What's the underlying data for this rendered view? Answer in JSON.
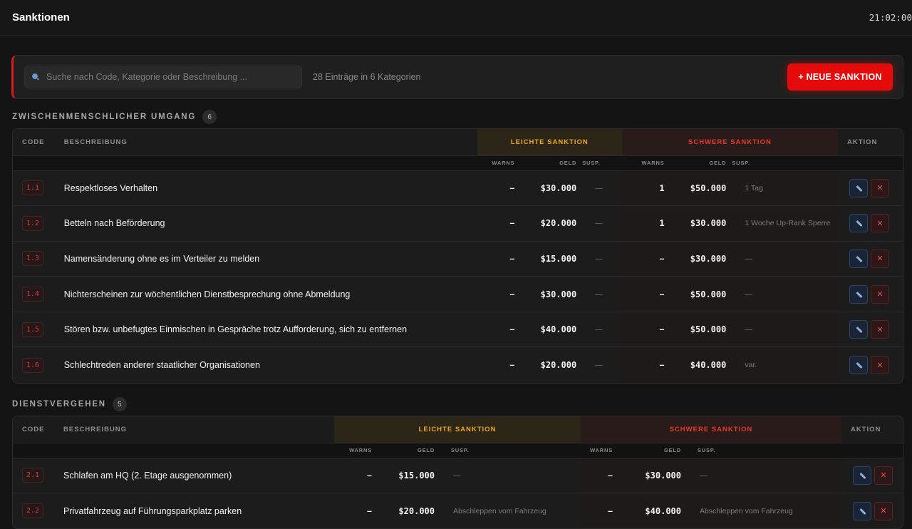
{
  "header": {
    "title": "Sanktionen",
    "clock": "21:02:00"
  },
  "toolbar": {
    "search_placeholder": "Suche nach Code, Kategorie oder Beschreibung ...",
    "entry_count": "28 Einträge in 6 Kategorien",
    "new_button": "+ NEUE SANKTION"
  },
  "columns": {
    "code": "CODE",
    "desc": "BESCHREIBUNG",
    "light": "LEICHTE SANKTION",
    "heavy": "SCHWERE SANKTION",
    "action": "AKTION",
    "warns": "WARNS",
    "geld": "GELD",
    "susp": "SUSP."
  },
  "sections": [
    {
      "title": "ZWISCHENMENSCHLICHER UMGANG",
      "count": "6",
      "rows": [
        {
          "code": "1.1",
          "desc": "Respektloses Verhalten",
          "l_warns": "–",
          "l_geld": "$30.000",
          "l_susp": "—",
          "h_warns": "1",
          "h_geld": "$50.000",
          "h_susp": "1 Tag"
        },
        {
          "code": "1.2",
          "desc": "Betteln nach Beförderung",
          "l_warns": "–",
          "l_geld": "$20.000",
          "l_susp": "—",
          "h_warns": "1",
          "h_geld": "$30.000",
          "h_susp": "1 Woche Up-Rank Sperre"
        },
        {
          "code": "1.3",
          "desc": "Namensänderung ohne es im Verteiler zu melden",
          "l_warns": "–",
          "l_geld": "$15.000",
          "l_susp": "—",
          "h_warns": "–",
          "h_geld": "$30.000",
          "h_susp": "—"
        },
        {
          "code": "1.4",
          "desc": "Nichterscheinen zur wöchentlichen Dienstbesprechung ohne Abmeldung",
          "l_warns": "–",
          "l_geld": "$30.000",
          "l_susp": "—",
          "h_warns": "–",
          "h_geld": "$50.000",
          "h_susp": "—"
        },
        {
          "code": "1.5",
          "desc": "Stören bzw. unbefugtes Einmischen in Gespräche trotz Aufforderung, sich zu entfernen",
          "l_warns": "–",
          "l_geld": "$40.000",
          "l_susp": "—",
          "h_warns": "–",
          "h_geld": "$50.000",
          "h_susp": "—"
        },
        {
          "code": "1.6",
          "desc": "Schlechtreden anderer staatlicher Organisationen",
          "l_warns": "–",
          "l_geld": "$20.000",
          "l_susp": "—",
          "h_warns": "–",
          "h_geld": "$40.000",
          "h_susp": "var."
        }
      ]
    },
    {
      "title": "DIENSTVERGEHEN",
      "count": "5",
      "rows": [
        {
          "code": "2.1",
          "desc": "Schlafen am HQ (2. Etage ausgenommen)",
          "l_warns": "–",
          "l_geld": "$15.000",
          "l_susp": "—",
          "h_warns": "–",
          "h_geld": "$30.000",
          "h_susp": "—"
        },
        {
          "code": "2.2",
          "desc": "Privatfahrzeug auf Führungsparkplatz parken",
          "l_warns": "–",
          "l_geld": "$20.000",
          "l_susp": "Abschleppen vom Fahrzeug",
          "h_warns": "–",
          "h_geld": "$40.000",
          "h_susp": "Abschleppen vom Fahrzeug"
        }
      ]
    }
  ]
}
